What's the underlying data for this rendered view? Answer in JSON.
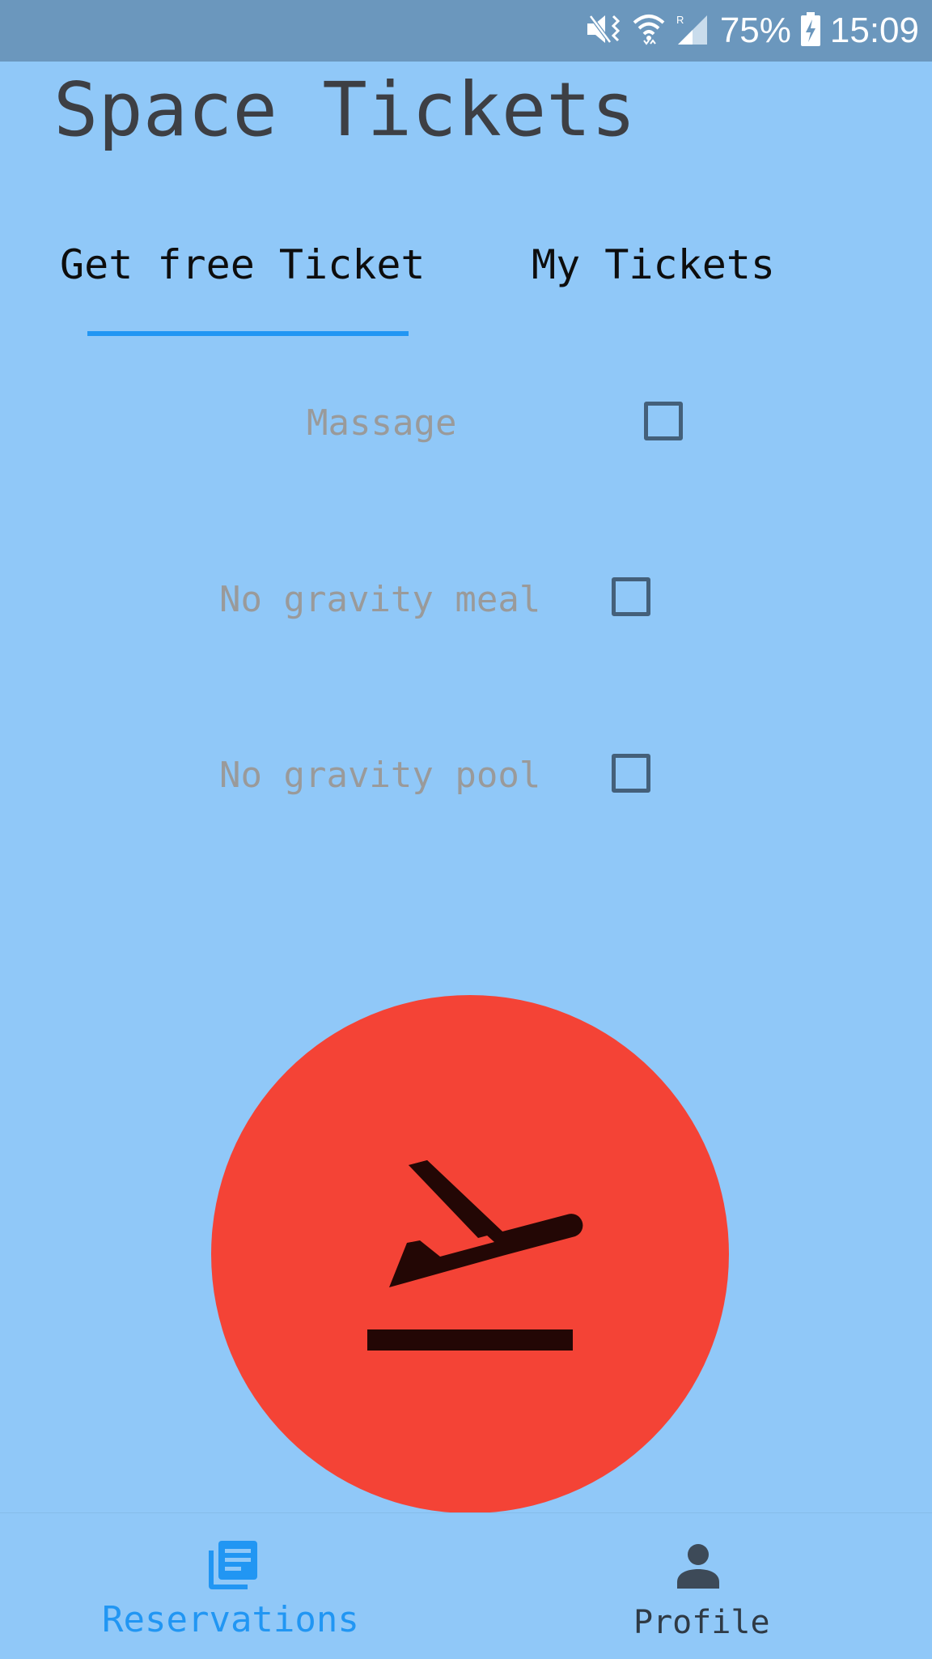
{
  "status_bar": {
    "battery": "75%",
    "time": "15:09"
  },
  "app": {
    "title": "Space Tickets"
  },
  "tabs": [
    {
      "label": "Get free Ticket",
      "selected": true
    },
    {
      "label": "My Tickets",
      "selected": false
    }
  ],
  "options": [
    {
      "label": "Massage",
      "checked": false
    },
    {
      "label": "No gravity meal",
      "checked": false
    },
    {
      "label": "No gravity pool",
      "checked": false
    }
  ],
  "fab": {
    "icon": "flight-takeoff-icon"
  },
  "bottom_nav": {
    "items": [
      {
        "label": "Reservations",
        "icon": "library-books-icon",
        "selected": true
      },
      {
        "label": "Profile",
        "icon": "person-icon",
        "selected": false
      }
    ]
  },
  "colors": {
    "background": "#90c8f8",
    "status_bar": "#6b97bd",
    "accent": "#2196f3",
    "fab": "#f44336",
    "title": "#3d3f44"
  }
}
